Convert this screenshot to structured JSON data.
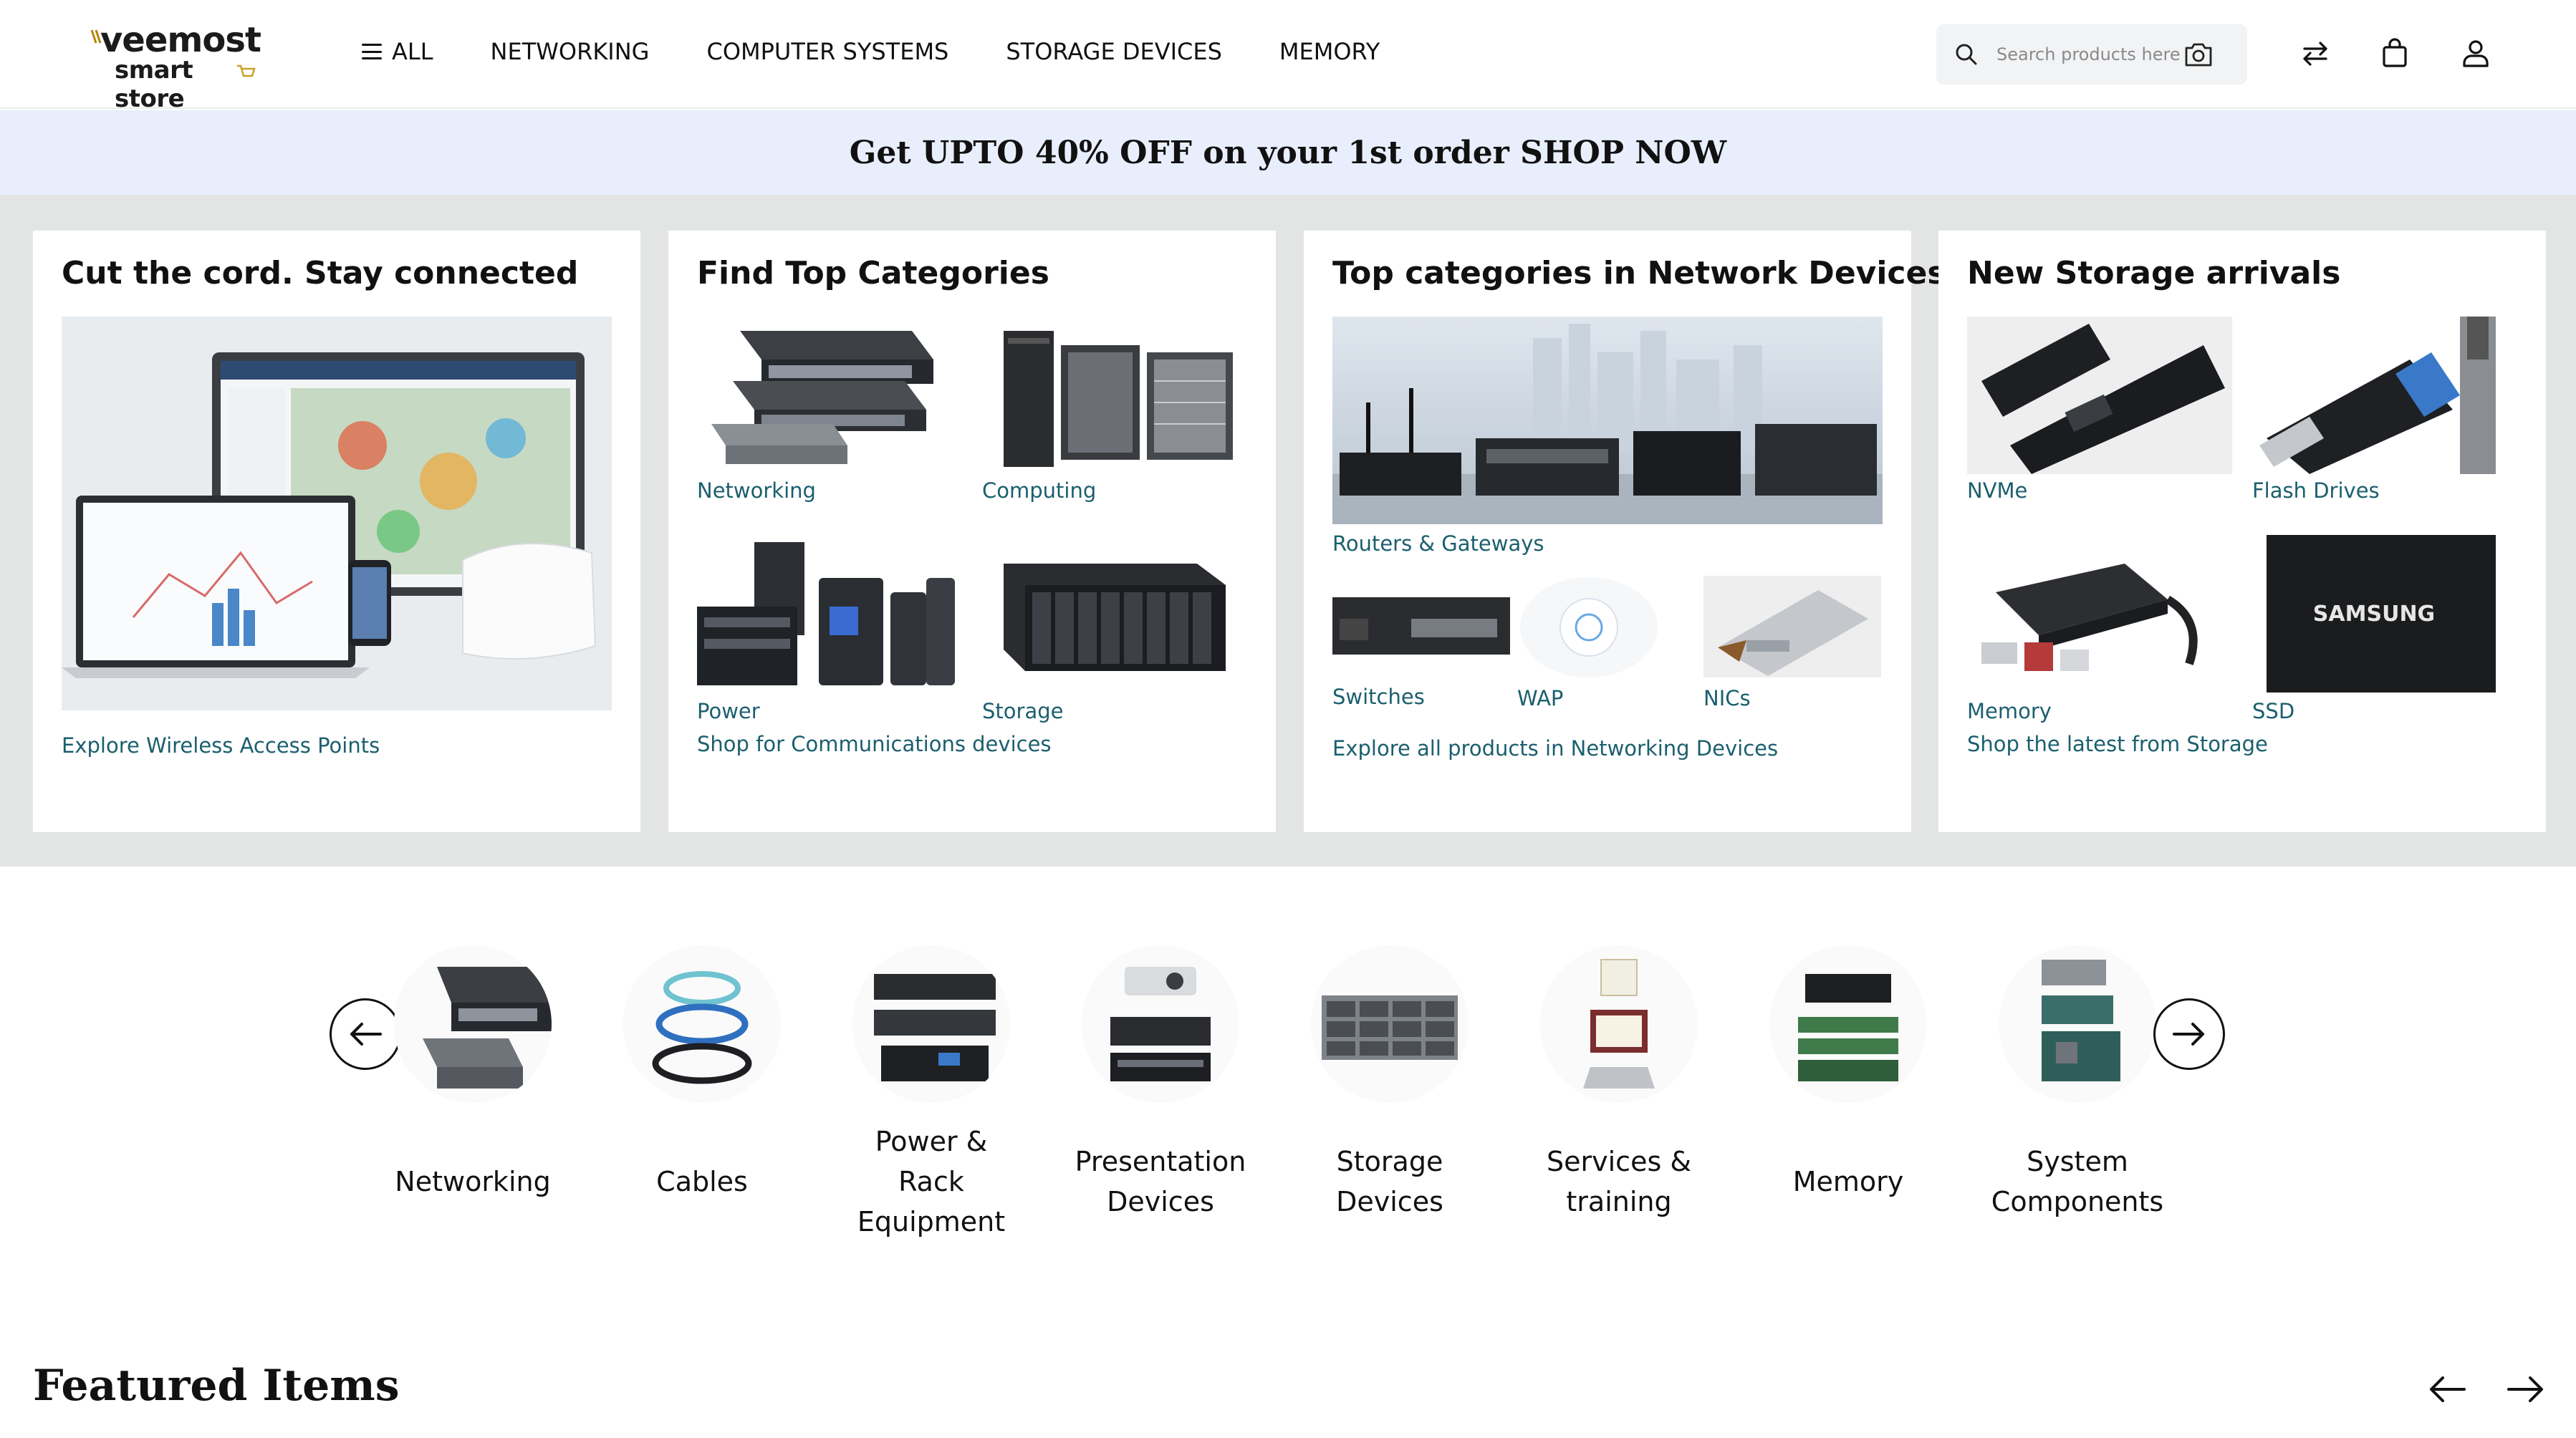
{
  "header": {
    "logo": {
      "brand": "veemost",
      "sub": "smart store"
    },
    "nav": [
      {
        "label": "ALL",
        "has_menu_icon": true
      },
      {
        "label": "NETWORKING"
      },
      {
        "label": "COMPUTER SYSTEMS"
      },
      {
        "label": "STORAGE DEVICES"
      },
      {
        "label": "MEMORY"
      }
    ],
    "search": {
      "placeholder": "Search products here"
    },
    "icons": [
      "compare-icon",
      "bag-icon",
      "user-icon"
    ]
  },
  "promo": {
    "text": "Get UPTO 40% OFF on your 1st order SHOP NOW"
  },
  "cards": [
    {
      "title": "Cut the cord. Stay connected",
      "link": "Explore Wireless Access Points"
    },
    {
      "title": "Find Top Categories",
      "tiles": [
        "Networking",
        "Computing",
        "Power",
        "Storage"
      ],
      "link": "Shop for Communications devices"
    },
    {
      "title": "Top categories in Network Devices",
      "hero_label": "Routers & Gateways",
      "tiles": [
        "Switches",
        "WAP",
        "NICs"
      ],
      "link": "Explore all products in Networking Devices"
    },
    {
      "title": "New Storage arrivals",
      "tiles": [
        "NVMe",
        "Flash Drives",
        "Memory",
        "SSD"
      ],
      "link": "Shop the latest from Storage"
    }
  ],
  "categories": [
    {
      "lines": [
        "Networking"
      ]
    },
    {
      "lines": [
        "Cables"
      ]
    },
    {
      "lines": [
        "Power &",
        "Rack",
        "Equipment"
      ]
    },
    {
      "lines": [
        "Presentation",
        "Devices"
      ]
    },
    {
      "lines": [
        "Storage",
        "Devices"
      ]
    },
    {
      "lines": [
        "Services &",
        "training"
      ]
    },
    {
      "lines": [
        "Memory"
      ]
    },
    {
      "lines": [
        "System",
        "Components"
      ]
    }
  ],
  "featured": {
    "title": "Featured Items"
  },
  "colors": {
    "link": "#1b5f6e",
    "promo_bg": "#e9eefc",
    "cards_bg": "#e3e5e4"
  }
}
